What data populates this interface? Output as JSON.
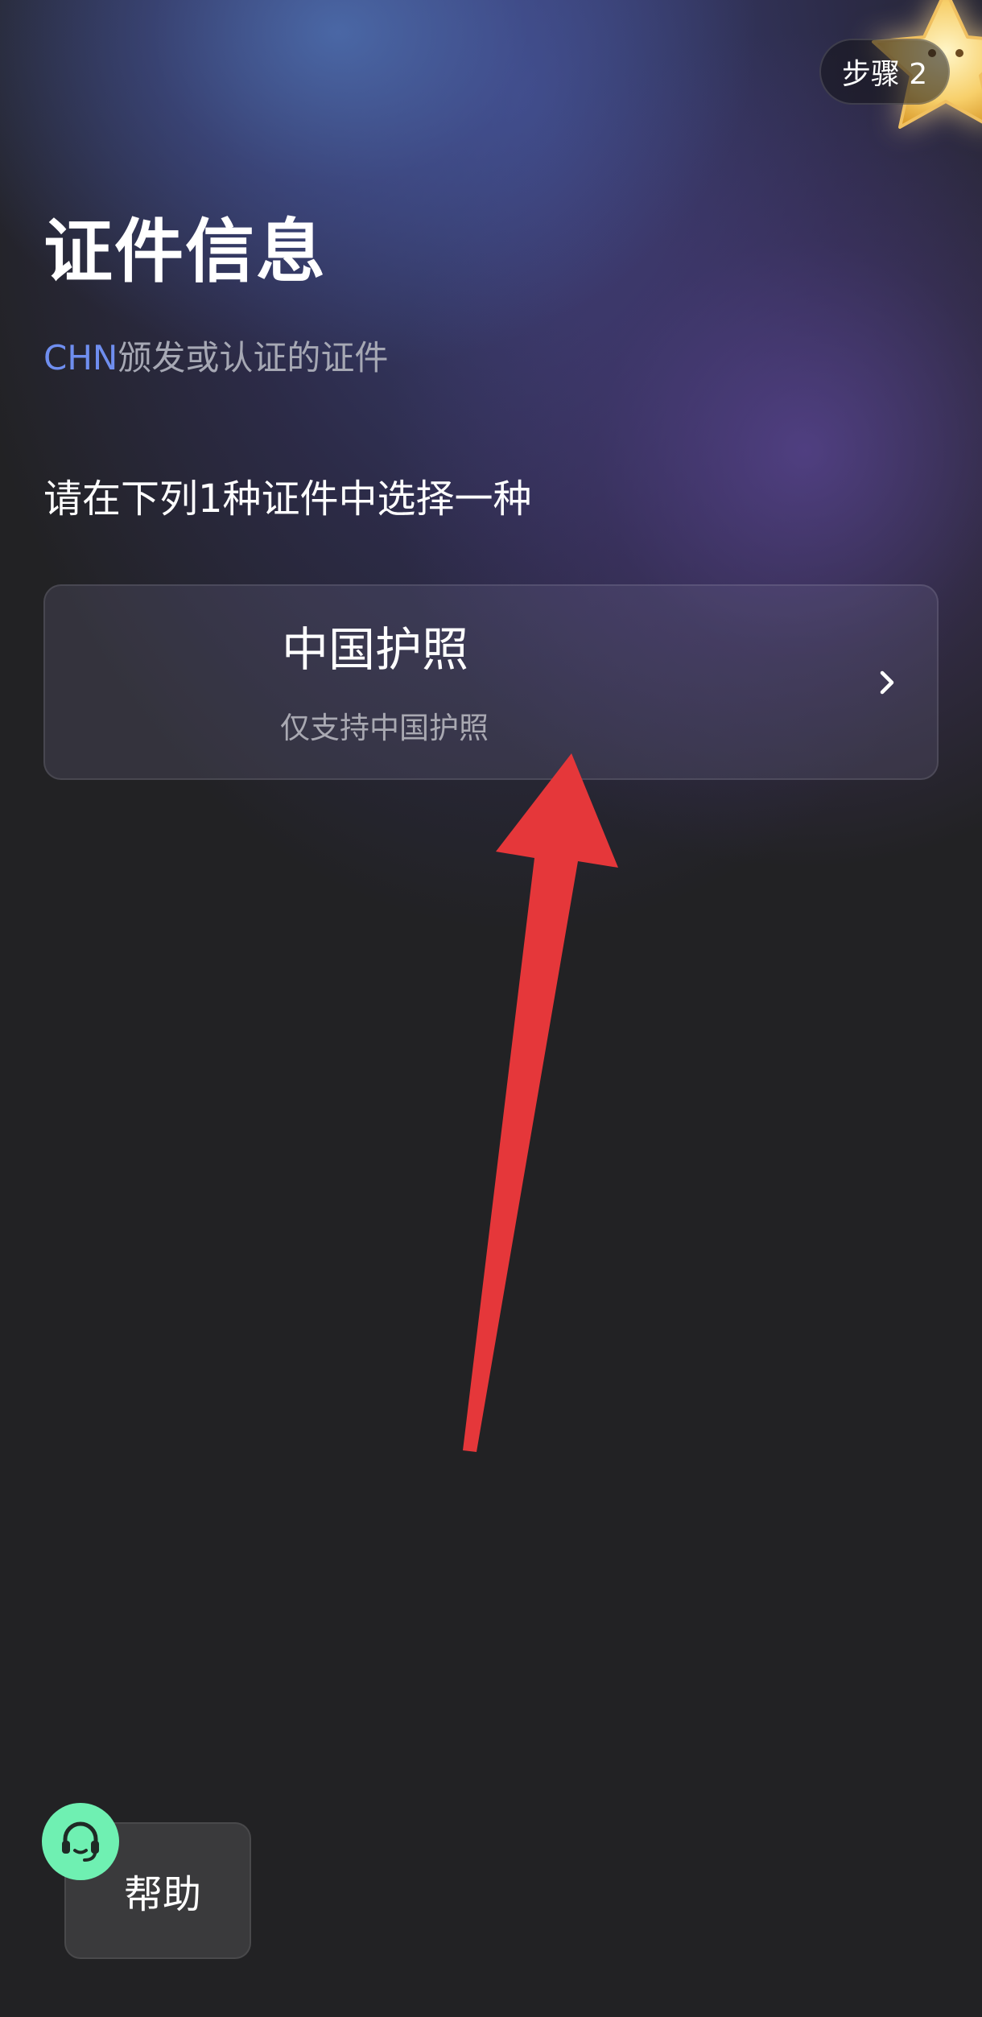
{
  "header": {
    "step_label": "步骤 2"
  },
  "page": {
    "title": "证件信息",
    "country_code": "CHN",
    "subtitle_text": "颁发或认证的证件",
    "prompt": "请在下列1种证件中选择一种"
  },
  "documents": [
    {
      "name": "中国护照",
      "description": "仅支持中国护照",
      "icon": "chevron-right-icon"
    }
  ],
  "help": {
    "label": "帮助",
    "icon": "headset-icon"
  },
  "colors": {
    "accent": "#6f8eef",
    "help_icon_bg": "#6ff0b2",
    "annotation_arrow": "#e5373a",
    "background": "#222224"
  }
}
